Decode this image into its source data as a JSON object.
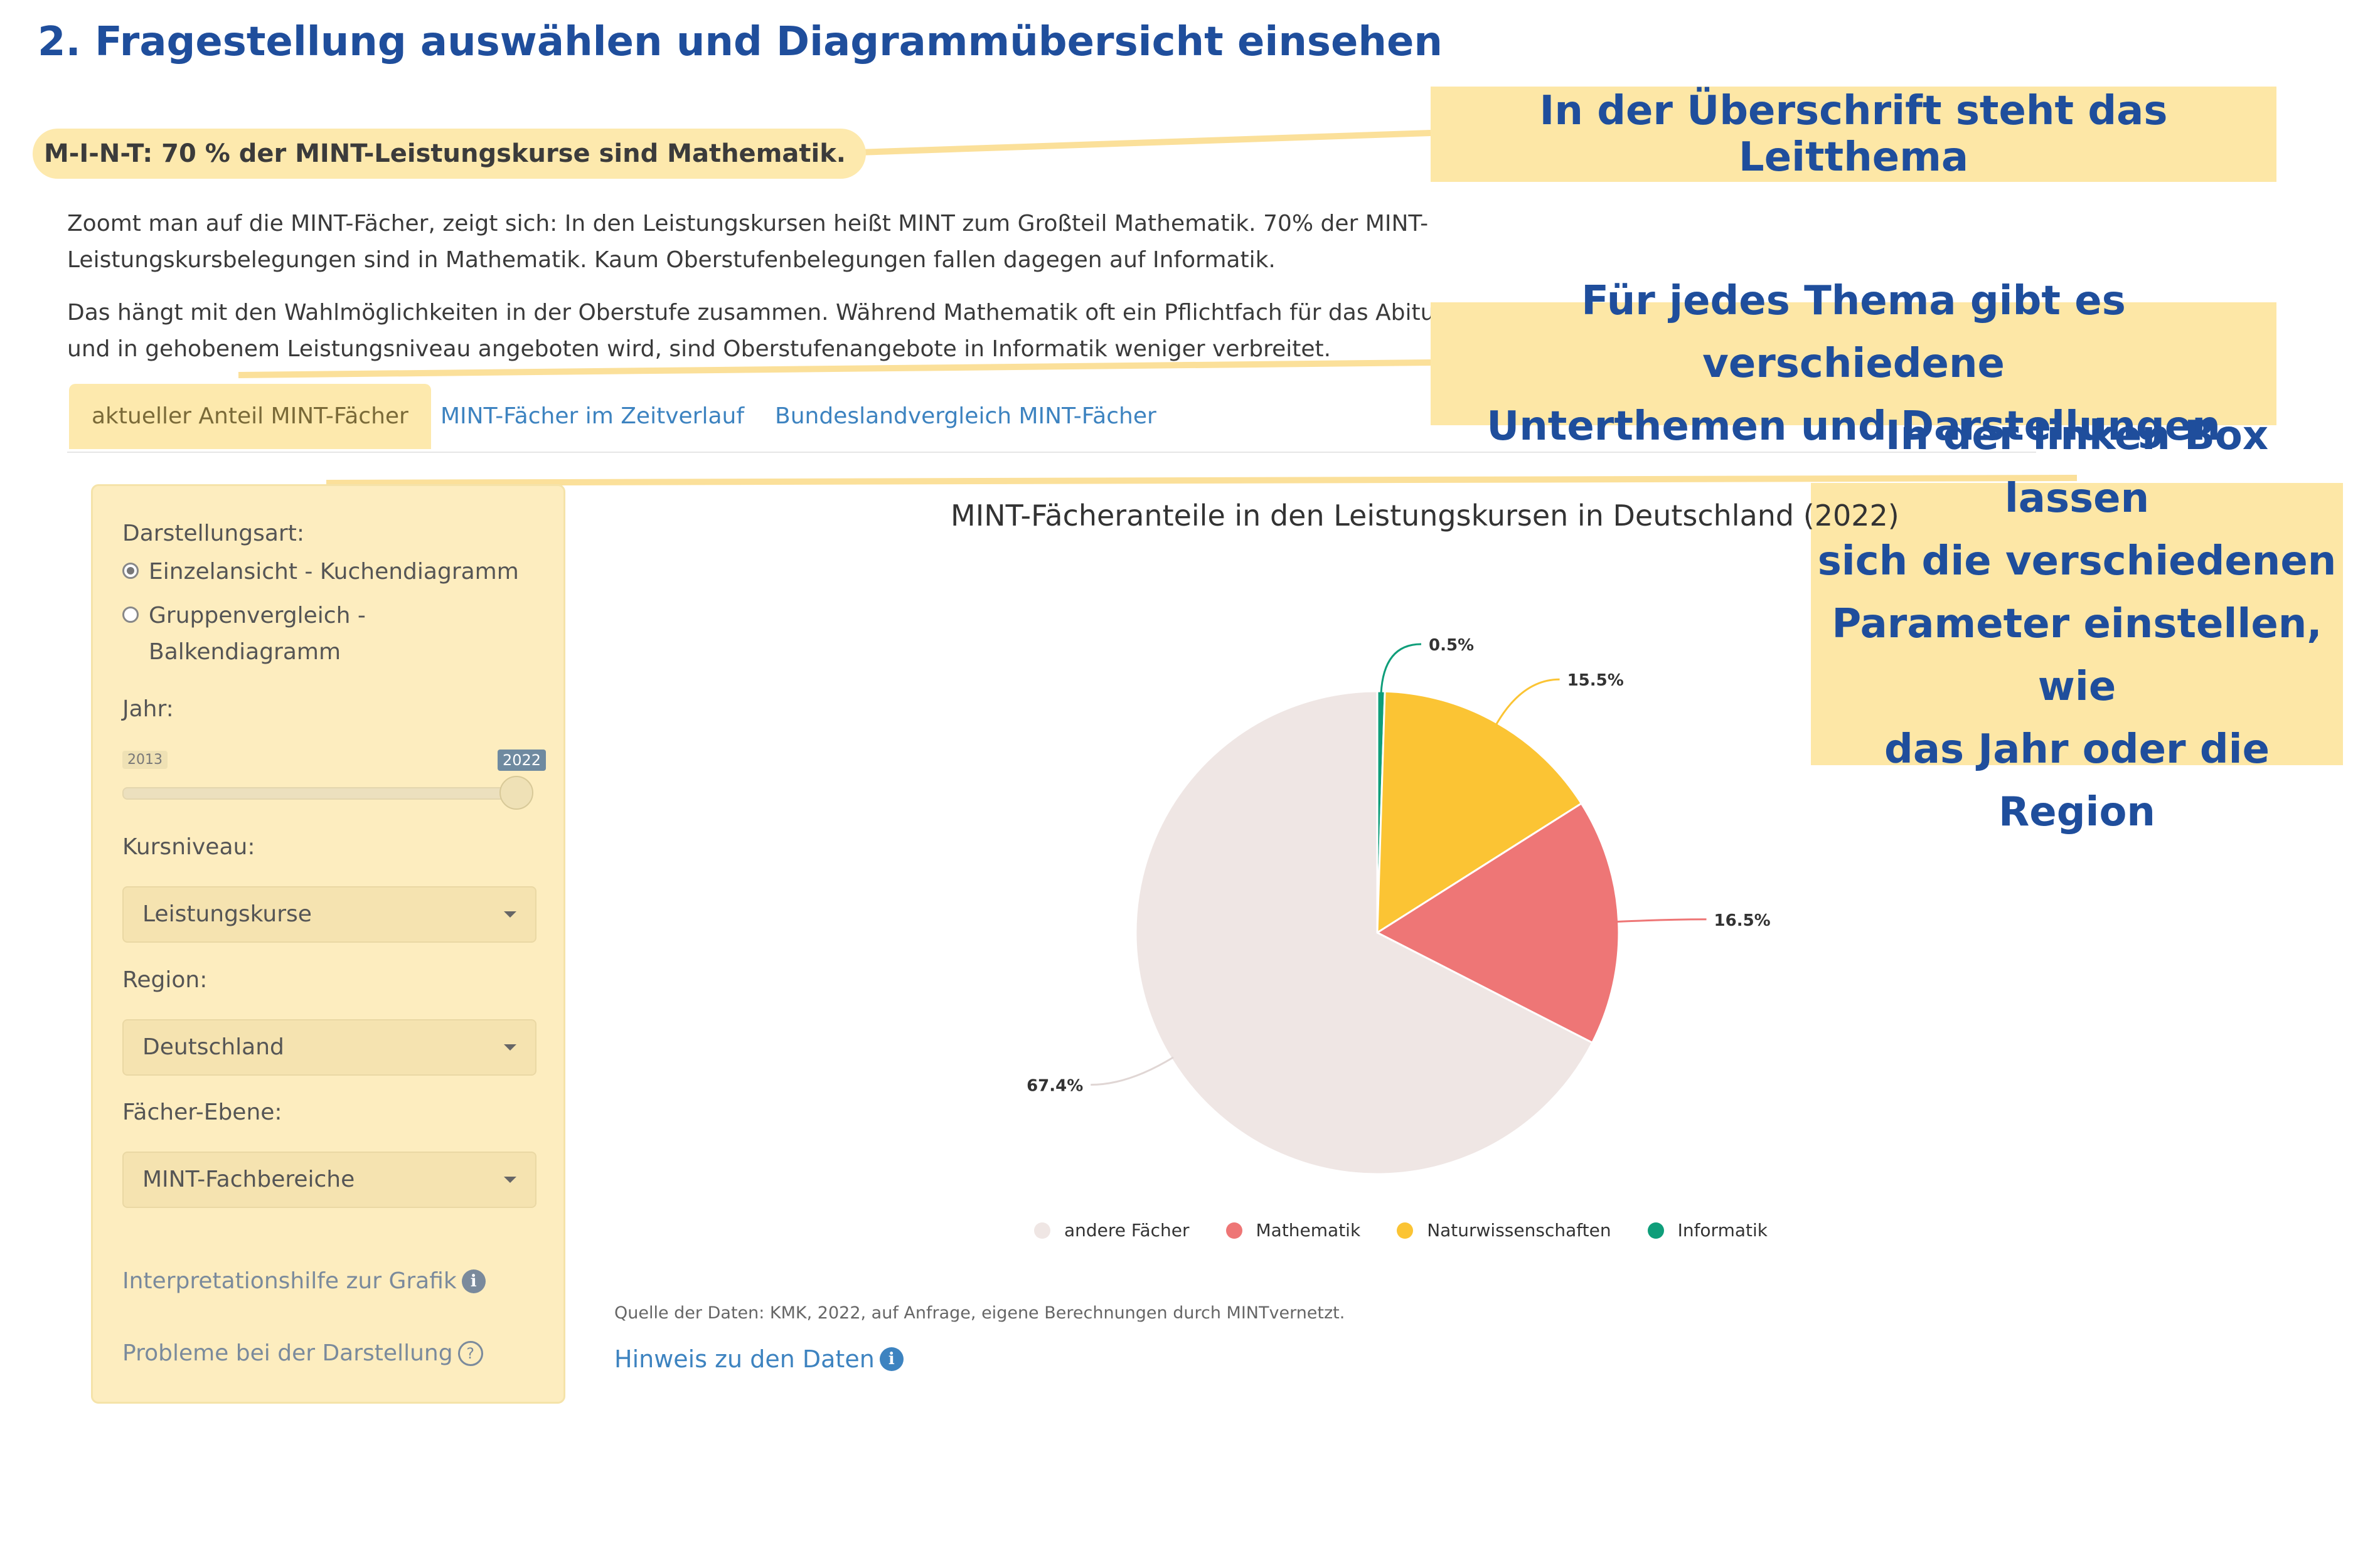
{
  "heading": "2. Fragestellung auswählen und Diagrammübersicht einsehen",
  "topic_title": "M-I-N-T: 70 % der MINT-Leistungskurse sind Mathematik.",
  "paragraphs": [
    "Zoomt man auf die MINT-Fächer, zeigt sich: In den Leistungskursen heißt MINT zum Großteil Mathematik. 70% der MINT-Leistungskursbelegungen sind in Mathematik. Kaum Oberstufenbelegungen fallen dagegen auf Informatik.",
    "Das hängt mit den Wahlmöglichkeiten in der Oberstufe zusammen. Während Mathematik oft ein Pflichtfach für das Abitur ist und in gehobenem Leistungsniveau angeboten wird, sind Oberstufenangebote in Informatik weniger verbreitet."
  ],
  "callouts": {
    "headline": "In der Überschrift steht das Leitthema",
    "subtopics_line1": "Für jedes Thema gibt es verschiedene",
    "subtopics_line2": "Unterthemen und Darstellungen",
    "box_line1": "In der linken Box lassen",
    "box_line2": "sich die verschiedenen",
    "box_line3": "Parameter einstellen, wie",
    "box_line4": "das Jahr oder die Region"
  },
  "tabs": [
    {
      "label": "aktueller Anteil MINT-Fächer",
      "active": true
    },
    {
      "label": "MINT-Fächer im Zeitverlauf",
      "active": false
    },
    {
      "label": "Bundeslandvergleich MINT-Fächer",
      "active": false
    }
  ],
  "panel": {
    "display_label": "Darstellungsart:",
    "radio_1": "Einzelansicht - Kuchendiagramm",
    "radio_2_line1": "Gruppenvergleich -",
    "radio_2_line2": "Balkendiagramm",
    "radio_selected": 1,
    "year_label": "Jahr:",
    "year_min": "2013",
    "year_value": "2022",
    "year_fraction": 1.0,
    "level_label": "Kursniveau:",
    "level_value": "Leistungskurse",
    "region_label": "Region:",
    "region_value": "Deutschland",
    "subject_label": "Fächer-Ebene:",
    "subject_value": "MINT-Fachbereiche",
    "help_link": "Interpretationshilfe zur Grafik",
    "problem_link": "Probleme bei der Darstellung"
  },
  "source_text": "Quelle der Daten: KMK, 2022, auf Anfrage, eigene Berechnungen durch MINTvernetzt.",
  "hint_link": "Hinweis zu den Daten",
  "colors": {
    "accent_blue": "#1f4e9c",
    "link_blue": "#3d83c0",
    "highlight": "#fde7a6"
  },
  "chart_data": {
    "type": "pie",
    "title": "MINT-Fächeranteile in den Leistungskursen in Deutschland (2022)",
    "categories": [
      "Informatik",
      "Naturwissenschaften",
      "Mathematik",
      "andere Fächer"
    ],
    "values": [
      0.5,
      15.5,
      16.5,
      67.4
    ],
    "labels": [
      "0.5%",
      "15.5%",
      "16.5%",
      "67.4%"
    ],
    "colors": [
      "#0f9e7a",
      "#fbc434",
      "#ee7676",
      "#efe6e4"
    ],
    "legend": [
      "andere Fächer",
      "Mathematik",
      "Naturwissenschaften",
      "Informatik"
    ],
    "legend_colors": [
      "#efe6e4",
      "#ee7676",
      "#fbc434",
      "#0f9e7a"
    ],
    "legend_position": "bottom"
  }
}
